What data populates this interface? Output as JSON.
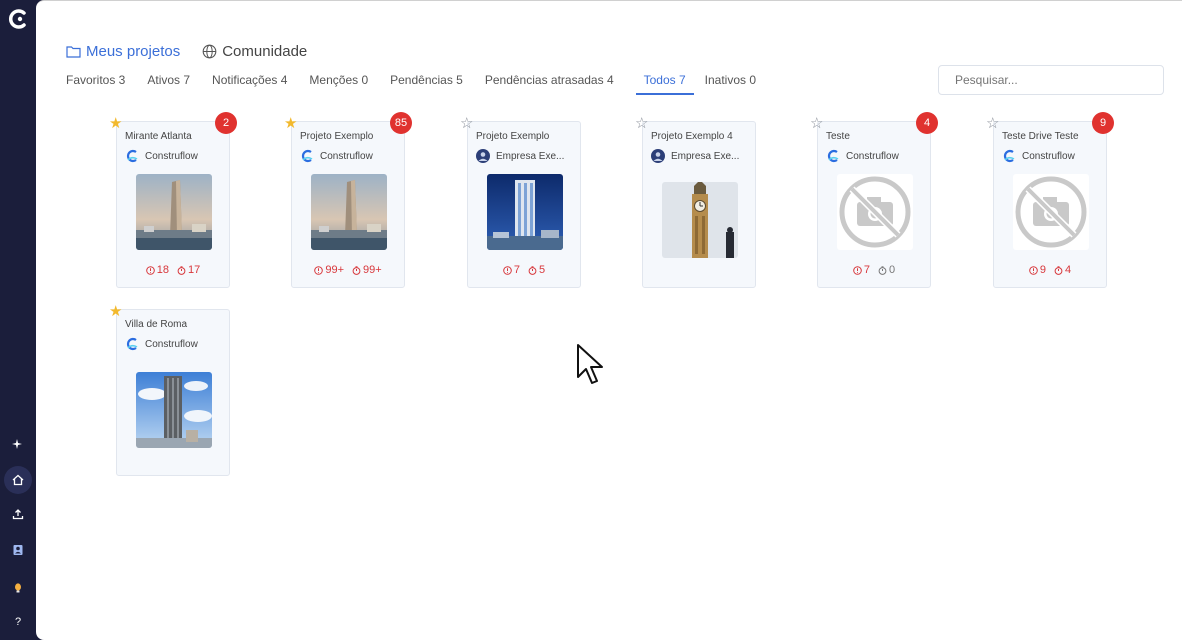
{
  "top_tabs": [
    {
      "label": "Meus projetos",
      "icon": "folder-icon"
    },
    {
      "label": "Comunidade",
      "icon": "globe-icon"
    }
  ],
  "filters": [
    "Favoritos 3",
    "Ativos 7",
    "Notificações 4",
    "Menções 0",
    "Pendências 5",
    "Pendências atrasadas 4",
    "Todos 7",
    "Inativos 0"
  ],
  "active_filter": "Todos 7",
  "search": {
    "placeholder": "Pesquisar..."
  },
  "projects": [
    {
      "title": "Mirante Atlanta",
      "company": "Construflow",
      "favorite": true,
      "badge": "2",
      "pending": "18",
      "late": "17",
      "image": "tower-photo"
    },
    {
      "title": "Projeto Exemplo",
      "company": "Construflow",
      "favorite": true,
      "badge": "85",
      "pending": "99+",
      "late": "99+",
      "image": "tower-photo"
    },
    {
      "title": "Projeto Exemplo",
      "company": "Empresa Exe...",
      "favorite": false,
      "badge": "",
      "pending": "7",
      "late": "5",
      "image": "building-night-photo"
    },
    {
      "title": "Projeto Exemplo 4",
      "company": "Empresa Exe...",
      "favorite": false,
      "badge": "",
      "pending": "",
      "late": "",
      "image": "big-ben-photo"
    },
    {
      "title": "Teste",
      "company": "Construflow",
      "favorite": false,
      "badge": "4",
      "pending": "7",
      "late": "0",
      "image": "no-photo"
    },
    {
      "title": "Teste Drive Teste",
      "company": "Construflow",
      "favorite": false,
      "badge": "9",
      "pending": "9",
      "late": "4",
      "image": "no-photo"
    },
    {
      "title": "Villa de Roma",
      "company": "Construflow",
      "favorite": true,
      "badge": "",
      "pending": "",
      "late": "",
      "image": "skyscraper-photo"
    }
  ],
  "colors": {
    "accent": "#3b6fd8",
    "badge": "#e0322f",
    "star": "#f2b92e",
    "sidebar": "#1b1e3b"
  }
}
